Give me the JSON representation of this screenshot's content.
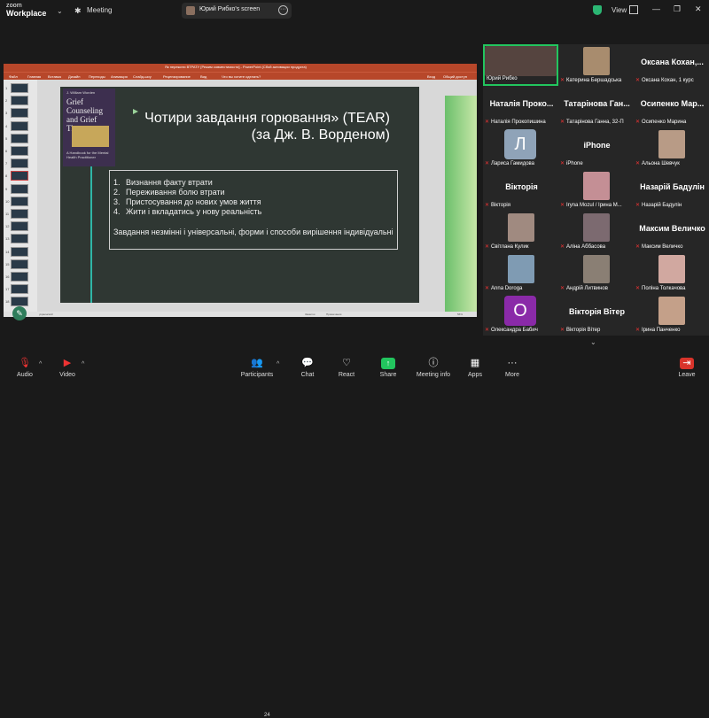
{
  "app": {
    "brand_small": "zoom",
    "brand_large": "Workplace"
  },
  "meeting_tab": {
    "label": "Meeting"
  },
  "share_pill": {
    "presenter_label": "Юрий Рибко's screen"
  },
  "topbar": {
    "view_label": "View"
  },
  "window_controls": {
    "minimize": "—",
    "restore": "❐",
    "close": "✕"
  },
  "presentation": {
    "window_title": "Як пережити ВТРАТУ [Режим совместимости] - PowerPoint (Сбой активации продукта)",
    "menu": [
      "Файл",
      "Главная",
      "Вставка",
      "Дизайн",
      "Переходы",
      "Анимация",
      "Слайд-шоу",
      "Рецензирование",
      "Вид",
      "Что вы хотите сделать?"
    ],
    "menu_right": [
      "Вход",
      "Общий доступ"
    ],
    "slide_numbers": [
      "1",
      "2",
      "3",
      "4",
      "5",
      "6",
      "7",
      "8",
      "9",
      "10",
      "11",
      "12",
      "13",
      "14",
      "15",
      "16",
      "17",
      "18"
    ],
    "selected_slide": "8",
    "book": {
      "author": "J. William Worden",
      "title": "Grief Counseling and Grief Therapy",
      "subtitle": "A Handbook for the Mental Health Practitioner"
    },
    "slide_title": "Чотири завдання горювання» (TEAR) (за Дж. В. Ворденом)",
    "tasks": [
      {
        "n": "1.",
        "text": "Визнання факту втрати"
      },
      {
        "n": "2.",
        "text": "Переживання болю втрати"
      },
      {
        "n": "3.",
        "text": "Пристосування до нових умов життя"
      },
      {
        "n": "4.",
        "text": "Жити і вкладатись у нову реальність"
      }
    ],
    "summary": "Завдання незмінні і універсальні, форми і способи вирішення індивідуальні",
    "status_left": "украинский",
    "status_notes": "Заметки",
    "status_comments": "Примечания",
    "zoom_pct": "56%"
  },
  "participants": [
    {
      "name": "Юрий Рибко",
      "kind": "photo",
      "color": "#55443f",
      "active": true,
      "muted": false
    },
    {
      "name": "Катерина Бершадська",
      "kind": "photo",
      "color": "#a88c6e",
      "muted": true
    },
    {
      "name": "Оксана Кохан, 1 курс",
      "kind": "text",
      "big": "Оксана Кохан,...",
      "muted": true
    },
    {
      "name": "Наталія Прокопишина",
      "kind": "text",
      "big": "Наталія Проко...",
      "muted": true
    },
    {
      "name": "Татарінова Ганна, 32-П",
      "kind": "text",
      "big": "Татарінова Ган...",
      "muted": true
    },
    {
      "name": "Осипенко Марина",
      "kind": "text",
      "big": "Осипенко Мар...",
      "muted": true
    },
    {
      "name": "Лариса Гамидова",
      "kind": "letter",
      "letter": "Л",
      "color": "#8fa3b8",
      "muted": true
    },
    {
      "name": "iPhone",
      "kind": "text",
      "big": "iPhone",
      "muted": true
    },
    {
      "name": "Альона Шевчук",
      "kind": "photo",
      "color": "#b89b86",
      "muted": true
    },
    {
      "name": "Вікторія",
      "kind": "text",
      "big": "Вікторія",
      "muted": true
    },
    {
      "name": "Iryna Mozul / Ірина М...",
      "kind": "photo",
      "color": "#c48f95",
      "muted": true
    },
    {
      "name": "Назарій Бадулін",
      "kind": "text",
      "big": "Назарій Бадулін",
      "muted": true
    },
    {
      "name": "Світлана Кулик",
      "kind": "photo",
      "color": "#a08a80",
      "muted": true,
      "badge": true
    },
    {
      "name": "Аліна Аббасова",
      "kind": "photo",
      "color": "#7c6a70",
      "muted": true
    },
    {
      "name": "Максим Величко",
      "kind": "text",
      "big": "Максим Величко",
      "muted": true
    },
    {
      "name": "Anna Doroga",
      "kind": "photo",
      "color": "#7f9bb3",
      "muted": true,
      "badge": true
    },
    {
      "name": "Андрій Литвинов",
      "kind": "photo",
      "color": "#8a7f74",
      "muted": true,
      "badge": true
    },
    {
      "name": "Поліна Толкачова",
      "kind": "photo",
      "color": "#d1a8a0",
      "muted": true
    },
    {
      "name": "Олександра Бабич",
      "kind": "letter",
      "letter": "O",
      "color": "#8a2aa8",
      "muted": true
    },
    {
      "name": "Вікторія Вітер",
      "kind": "text",
      "big": "Вікторія Вітер",
      "muted": true
    },
    {
      "name": "Ірина Панченко",
      "kind": "photo",
      "color": "#c4a089",
      "muted": true
    }
  ],
  "toolbar": {
    "audio": "Audio",
    "video": "Video",
    "participants": "Participants",
    "participant_count": "24",
    "chat": "Chat",
    "react": "React",
    "share": "Share",
    "meeting_info": "Meeting info",
    "apps": "Apps",
    "more": "More",
    "leave": "Leave"
  }
}
